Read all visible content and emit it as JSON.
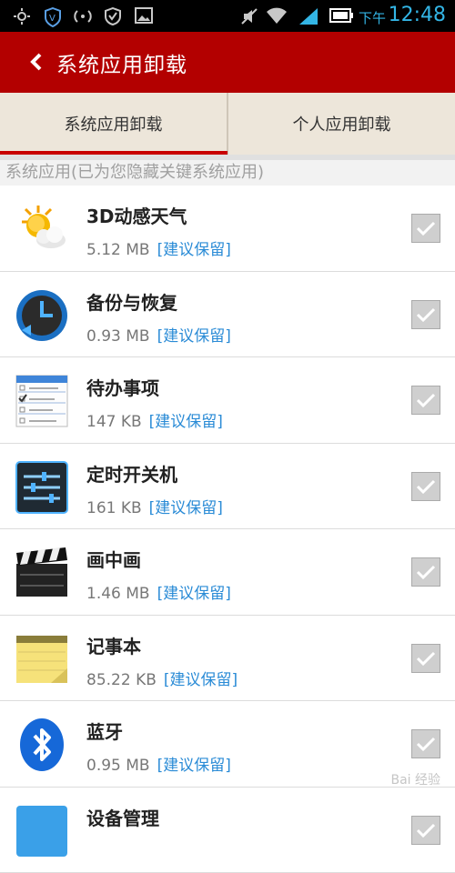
{
  "status_bar": {
    "ampm": "下午",
    "time": "12:48",
    "icons": [
      "brightness-icon",
      "shield-icon",
      "wifi-hotspot-icon",
      "vpn-icon",
      "image-icon",
      "mute-icon",
      "wifi-icon",
      "signal-icon",
      "battery-icon"
    ]
  },
  "title_bar": {
    "title": "系统应用卸载"
  },
  "tabs": [
    {
      "label": "系统应用卸载",
      "selected": true
    },
    {
      "label": "个人应用卸载",
      "selected": false
    }
  ],
  "section": {
    "header": "系统应用(已为您隐藏关键系统应用)"
  },
  "apps": [
    {
      "name": "3D动感天气",
      "size": "5.12 MB",
      "tag": "[建议保留]",
      "icon": "weather-icon",
      "checked": true
    },
    {
      "name": "备份与恢复",
      "size": "0.93 MB",
      "tag": "[建议保留]",
      "icon": "backup-restore-icon",
      "checked": true
    },
    {
      "name": "待办事项",
      "size": "147 KB",
      "tag": "[建议保留]",
      "icon": "todo-list-icon",
      "checked": true
    },
    {
      "name": "定时开关机",
      "size": "161 KB",
      "tag": "[建议保留]",
      "icon": "scheduled-power-icon",
      "checked": true
    },
    {
      "name": "画中画",
      "size": "1.46 MB",
      "tag": "[建议保留]",
      "icon": "clapperboard-icon",
      "checked": true
    },
    {
      "name": "记事本",
      "size": "85.22 KB",
      "tag": "[建议保留]",
      "icon": "notepad-icon",
      "checked": true
    },
    {
      "name": "蓝牙",
      "size": "0.95 MB",
      "tag": "[建议保留]",
      "icon": "bluetooth-icon",
      "checked": true
    },
    {
      "name": "设备管理",
      "size": "",
      "tag": "",
      "icon": "device-manager-icon",
      "checked": true
    }
  ],
  "watermark": "Bai 经验",
  "colors": {
    "title_bar": "#b30000",
    "tab_indicator": "#c80000",
    "tag_blue": "#2a8bd6",
    "tab_background": "#ede6da"
  }
}
